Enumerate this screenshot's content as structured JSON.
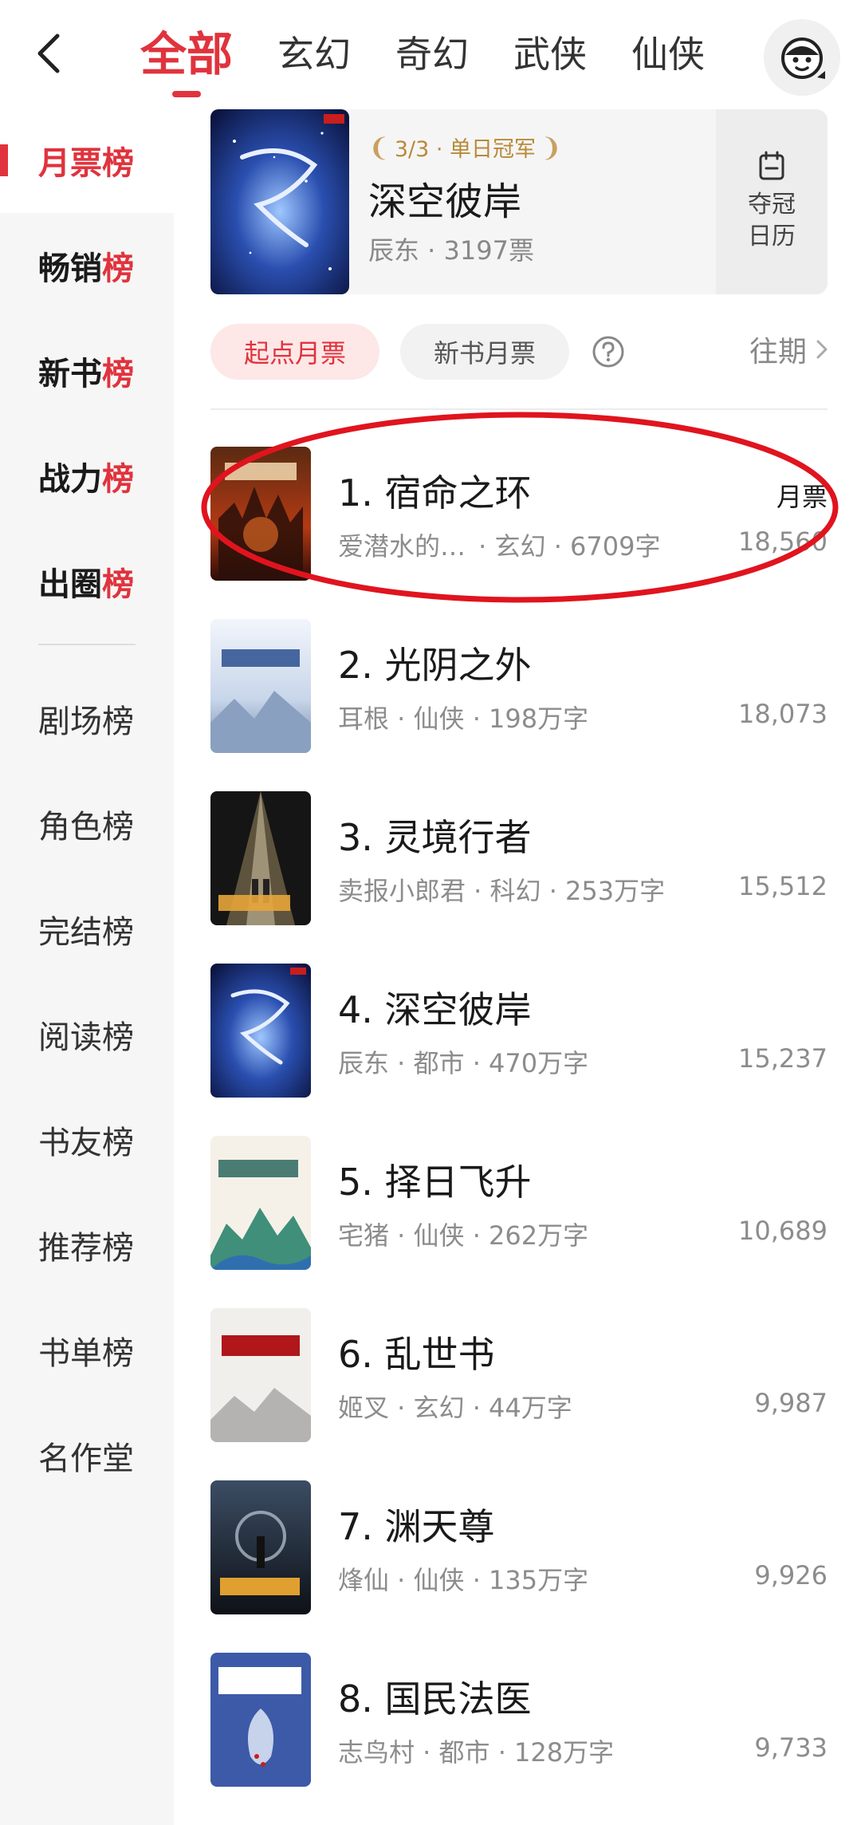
{
  "nav": {
    "tabs": [
      {
        "label": "全部",
        "active": true
      },
      {
        "label": "玄幻"
      },
      {
        "label": "奇幻"
      },
      {
        "label": "武侠"
      },
      {
        "label": "仙侠"
      }
    ],
    "avatar_icon": "avatar-monkey-icon"
  },
  "sidebar": {
    "items": [
      {
        "label": "月票榜",
        "active": true
      },
      {
        "label": "畅销榜"
      },
      {
        "label": "新书榜"
      },
      {
        "label": "战力榜"
      },
      {
        "label": "出圈榜"
      },
      {
        "label": "剧场榜"
      },
      {
        "label": "角色榜"
      },
      {
        "label": "完结榜"
      },
      {
        "label": "阅读榜"
      },
      {
        "label": "书友榜"
      },
      {
        "label": "推荐榜"
      },
      {
        "label": "书单榜"
      },
      {
        "label": "名作堂"
      }
    ]
  },
  "champion": {
    "badge": "3/3 · 单日冠军",
    "title": "深空彼岸",
    "meta": "辰东 · 3197票",
    "calendar_label": "夺冠日历"
  },
  "filters": {
    "active": "起点月票",
    "other": "新书月票",
    "history": "往期"
  },
  "list": {
    "vote_label": "月票",
    "books": [
      {
        "rank_title": "1. 宿命之环",
        "author": "爱潜水的…",
        "meta_rest": "· 玄幻 · 6709字",
        "votes": "18,560"
      },
      {
        "rank_title": "2. 光阴之外",
        "meta": "耳根 · 仙侠 · 198万字",
        "votes": "18,073"
      },
      {
        "rank_title": "3. 灵境行者",
        "meta": "卖报小郎君 · 科幻 · 253万字",
        "votes": "15,512"
      },
      {
        "rank_title": "4. 深空彼岸",
        "meta": "辰东 · 都市 · 470万字",
        "votes": "15,237"
      },
      {
        "rank_title": "5. 择日飞升",
        "meta": "宅猪 · 仙侠 · 262万字",
        "votes": "10,689"
      },
      {
        "rank_title": "6. 乱世书",
        "meta": "姬叉 · 玄幻 · 44万字",
        "votes": "9,987"
      },
      {
        "rank_title": "7. 渊天尊",
        "meta": "烽仙 · 仙侠 · 135万字",
        "votes": "9,926"
      },
      {
        "rank_title": "8. 国民法医",
        "meta": "志鸟村 · 都市 · 128万字",
        "votes": "9,733"
      }
    ]
  },
  "colors": {
    "accent": "#e0333d",
    "highlight": "#e0141e",
    "gold": "#b88a3a"
  }
}
